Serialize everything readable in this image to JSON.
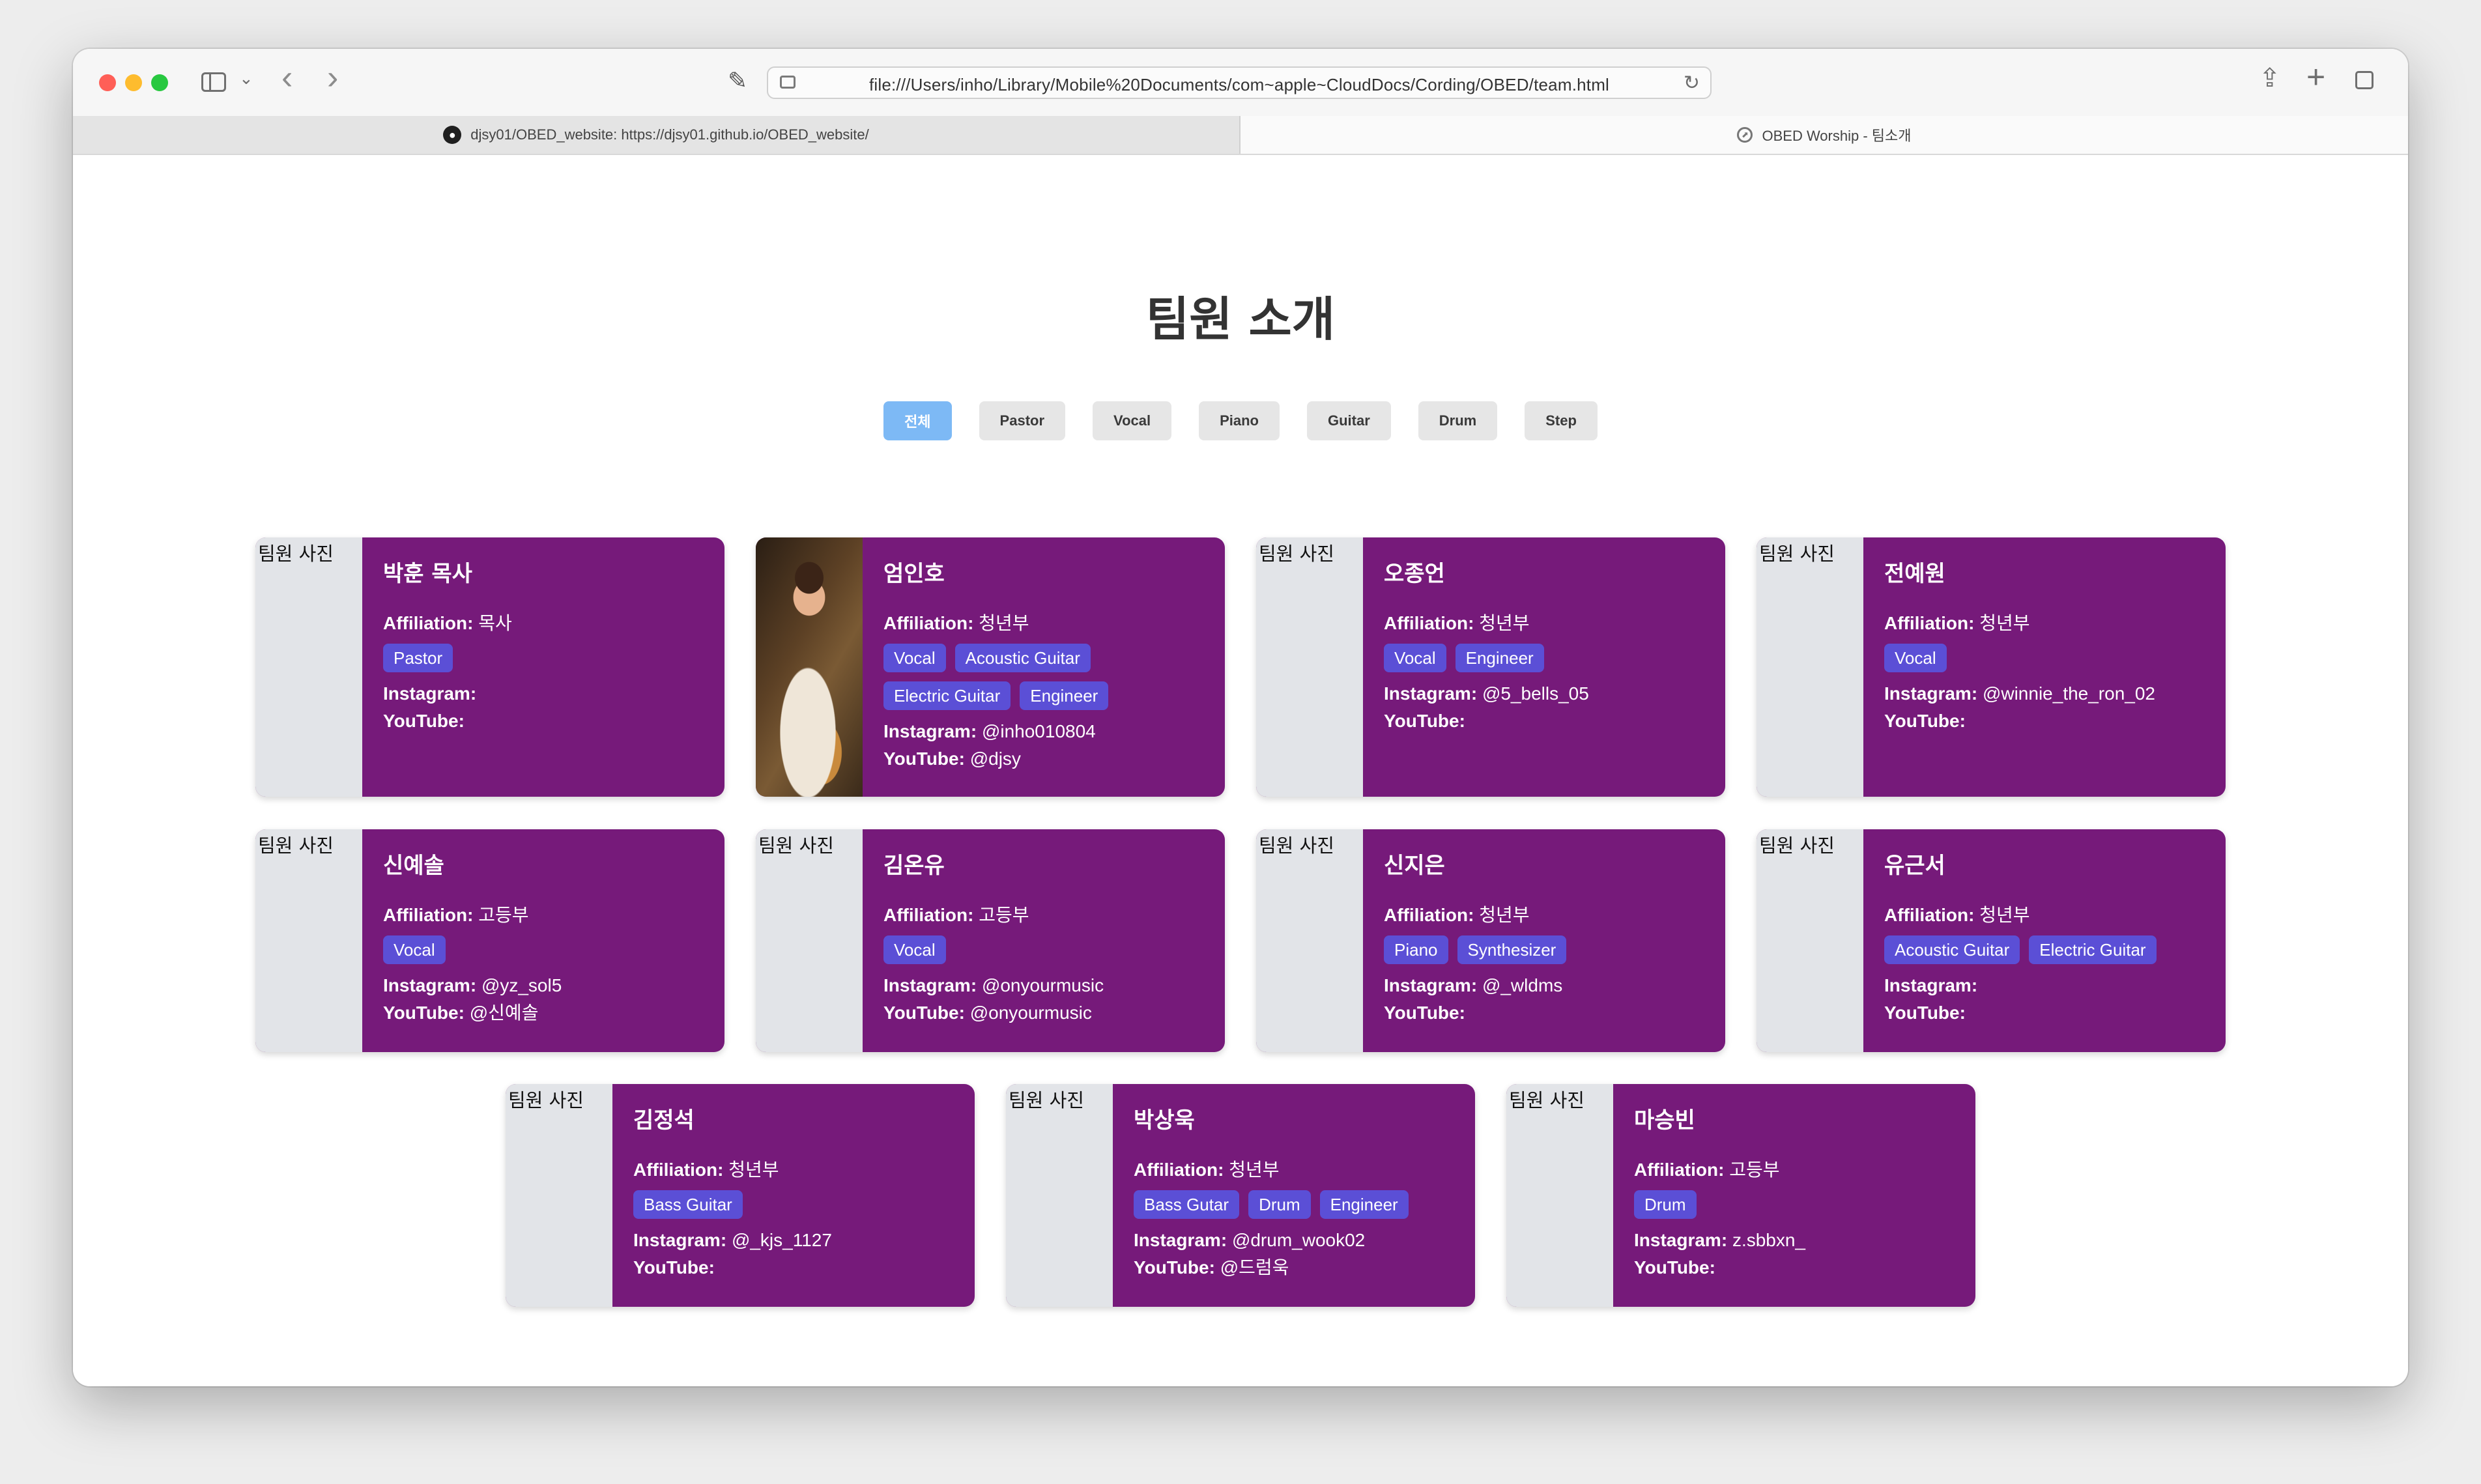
{
  "browser": {
    "url": "file:///Users/inho/Library/Mobile%20Documents/com~apple~CloudDocs/Cording/OBED/team.html",
    "tabs": [
      {
        "label": "djsy01/OBED_website: https://djsy01.github.io/OBED_website/",
        "icon": "github-icon"
      },
      {
        "label": "OBED Worship - 팀소개",
        "icon": "compass-icon"
      }
    ]
  },
  "page": {
    "title": "팀원 소개",
    "photo_placeholder": "팀원 사진",
    "filters": [
      "전체",
      "Pastor",
      "Vocal",
      "Piano",
      "Guitar",
      "Drum",
      "Step"
    ],
    "labels": {
      "affiliation": "Affiliation:",
      "instagram": "Instagram:",
      "youtube": "YouTube:"
    }
  },
  "members": [
    {
      "name": "박훈 목사",
      "affiliation": "목사",
      "tags": [
        "Pastor"
      ],
      "instagram": "",
      "youtube": ""
    },
    {
      "name": "엄인호",
      "affiliation": "청년부",
      "tags": [
        "Vocal",
        "Acoustic Guitar",
        "Electric Guitar",
        "Engineer"
      ],
      "instagram": "@inho010804",
      "youtube": "@djsy"
    },
    {
      "name": "오종언",
      "affiliation": "청년부",
      "tags": [
        "Vocal",
        "Engineer"
      ],
      "instagram": "@5_bells_05",
      "youtube": ""
    },
    {
      "name": "전예원",
      "affiliation": "청년부",
      "tags": [
        "Vocal"
      ],
      "instagram": "@winnie_the_ron_02",
      "youtube": ""
    },
    {
      "name": "신예솔",
      "affiliation": "고등부",
      "tags": [
        "Vocal"
      ],
      "instagram": "@yz_sol5",
      "youtube": "@신예솔"
    },
    {
      "name": "김온유",
      "affiliation": "고등부",
      "tags": [
        "Vocal"
      ],
      "instagram": "@onyourmusic",
      "youtube": "@onyourmusic"
    },
    {
      "name": "신지은",
      "affiliation": "청년부",
      "tags": [
        "Piano",
        "Synthesizer"
      ],
      "instagram": "@_wldms",
      "youtube": ""
    },
    {
      "name": "유근서",
      "affiliation": "청년부",
      "tags": [
        "Acoustic Guitar",
        "Electric Guitar"
      ],
      "instagram": "",
      "youtube": ""
    },
    {
      "name": "김정석",
      "affiliation": "청년부",
      "tags": [
        "Bass Guitar"
      ],
      "instagram": "@_kjs_1127",
      "youtube": ""
    },
    {
      "name": "박상욱",
      "affiliation": "청년부",
      "tags": [
        "Bass Gutar",
        "Drum",
        "Engineer"
      ],
      "instagram": "@drum_wook02",
      "youtube": "@드럼욱"
    },
    {
      "name": "마승빈",
      "affiliation": "고등부",
      "tags": [
        "Drum"
      ],
      "instagram": "z.sbbxn_",
      "youtube": ""
    }
  ],
  "colors": {
    "card_bg": "#761a7a",
    "tag_bg": "#5b4fd6",
    "filter_active": "#7db9f5",
    "filter_bg": "#e6e6e6"
  }
}
